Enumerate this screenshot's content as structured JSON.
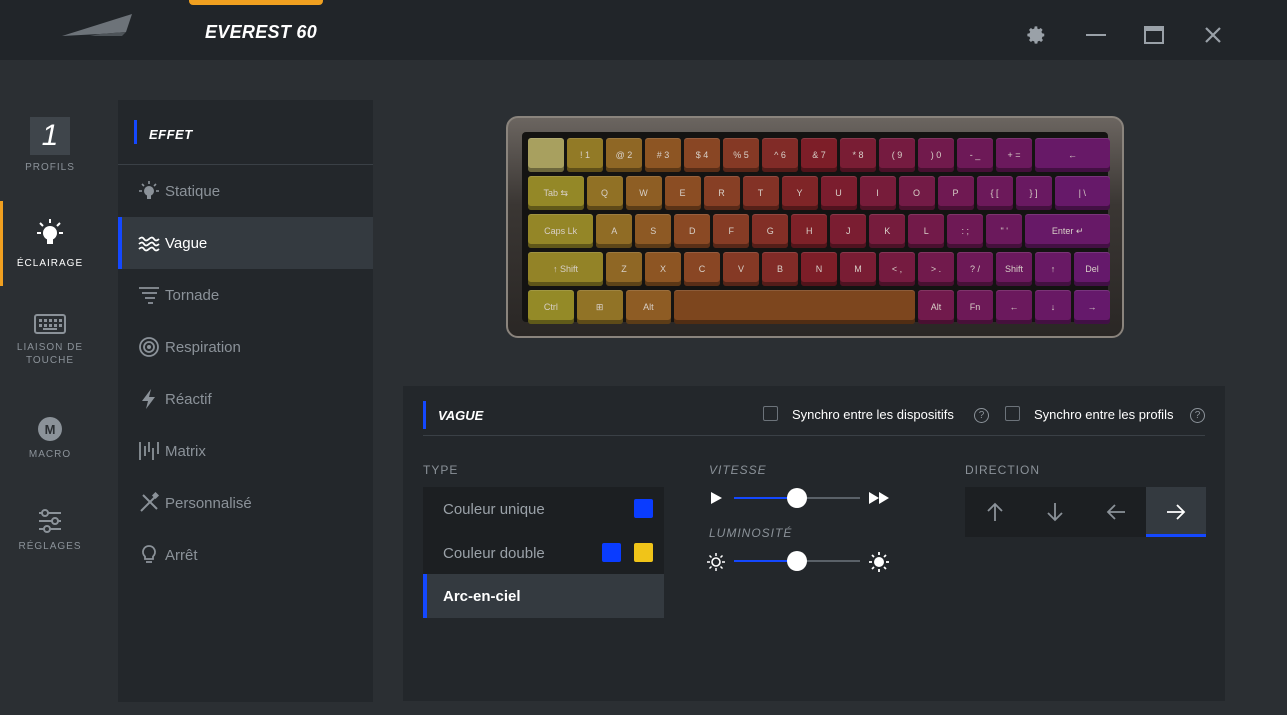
{
  "app": {
    "title": "EVEREST 60"
  },
  "nav": {
    "profile_number": "1",
    "items": [
      {
        "label": "PROFILS",
        "icon": "profile-number-icon"
      },
      {
        "label": "ÉCLAIRAGE",
        "icon": "lightbulb-icon",
        "active": true
      },
      {
        "label": "LIAISON DE TOUCHE",
        "icon": "keyboard-icon"
      },
      {
        "label": "MACRO",
        "icon": "macro-m-icon"
      },
      {
        "label": "RÉGLAGES",
        "icon": "sliders-icon"
      }
    ]
  },
  "effect": {
    "header": "EFFET",
    "items": [
      {
        "label": "Statique",
        "icon": "bulb-rays-icon"
      },
      {
        "label": "Vague",
        "icon": "wave-icon",
        "active": true
      },
      {
        "label": "Tornade",
        "icon": "tornado-icon"
      },
      {
        "label": "Respiration",
        "icon": "breath-icon"
      },
      {
        "label": "Réactif",
        "icon": "bolt-icon"
      },
      {
        "label": "Matrix",
        "icon": "matrix-icon"
      },
      {
        "label": "Personnalisé",
        "icon": "custom-brush-icon"
      },
      {
        "label": "Arrêt",
        "icon": "bulb-off-icon"
      }
    ]
  },
  "keyboard": {
    "rows": [
      [
        "",
        "! 1",
        "@ 2",
        "# 3",
        "$ 4",
        "% 5",
        "^ 6",
        "& 7",
        "* 8",
        "( 9",
        ") 0",
        "- _",
        "+ =",
        "←"
      ],
      [
        "Tab ⇆",
        "Q",
        "W",
        "E",
        "R",
        "T",
        "Y",
        "U",
        "I",
        "O",
        "P",
        "{ [",
        "} ]",
        "| \\"
      ],
      [
        "Caps Lk",
        "A",
        "S",
        "D",
        "F",
        "G",
        "H",
        "J",
        "K",
        "L",
        ": ;",
        "\" '",
        "Enter ↵"
      ],
      [
        "↑ Shift",
        "Z",
        "X",
        "C",
        "V",
        "B",
        "N",
        "M",
        "< ,",
        "> .",
        "? /",
        "Shift",
        "↑",
        "Del"
      ],
      [
        "Ctrl",
        "⊞",
        "Alt",
        "",
        "Alt",
        "Fn",
        "←",
        "↓",
        "→"
      ]
    ]
  },
  "settings": {
    "title": "VAGUE",
    "sync_devices": "Synchro entre les dispositifs",
    "sync_profiles": "Synchro entre les profils",
    "help": "?",
    "type_label": "TYPE",
    "types": [
      {
        "label": "Couleur unique"
      },
      {
        "label": "Couleur double"
      },
      {
        "label": "Arc-en-ciel",
        "active": true
      }
    ],
    "colors": {
      "single": "#0a3cff",
      "double_a": "#0a3cff",
      "double_b": "#f0c419",
      "accent": "#1448ff"
    },
    "speed_label": "VITESSE",
    "speed_value": 0.5,
    "brightness_label": "LUMINOSITÉ",
    "brightness_value": 0.5,
    "direction_label": "DIRECTION",
    "directions": [
      "↑",
      "↓",
      "←",
      "→"
    ],
    "direction_active": "→"
  }
}
